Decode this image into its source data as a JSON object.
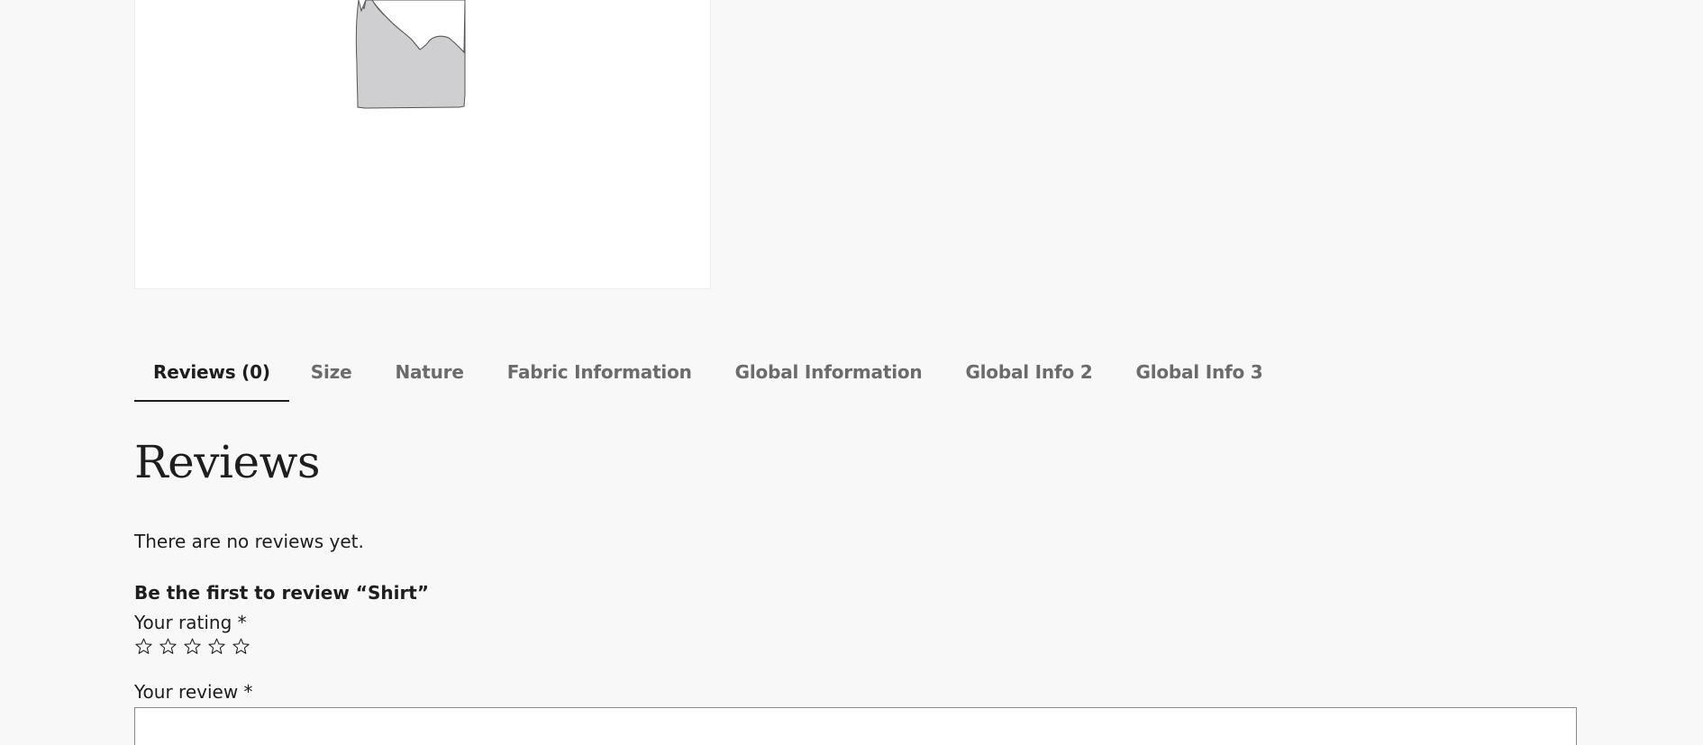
{
  "product_image": {
    "icon": "image-placeholder-icon"
  },
  "tabs": [
    {
      "label": "Reviews (0)",
      "active": true
    },
    {
      "label": "Size",
      "active": false
    },
    {
      "label": "Nature",
      "active": false
    },
    {
      "label": "Fabric Information",
      "active": false
    },
    {
      "label": "Global Information",
      "active": false
    },
    {
      "label": "Global Info 2",
      "active": false
    },
    {
      "label": "Global Info 3",
      "active": false
    }
  ],
  "reviews": {
    "heading": "Reviews",
    "empty_message": "There are no reviews yet.",
    "form_title": "Be the first to review “Shirt”",
    "rating_label": "Your rating *",
    "rating": 0,
    "rating_max": 5,
    "star_icon": "star-outline-icon",
    "review_label": "Your review *",
    "review_value": ""
  },
  "colors": {
    "background": "#f8f8f8",
    "text": "#1e1e1e",
    "tab_inactive": "#6b6b6b",
    "placeholder_fill": "#cfcfd2"
  }
}
